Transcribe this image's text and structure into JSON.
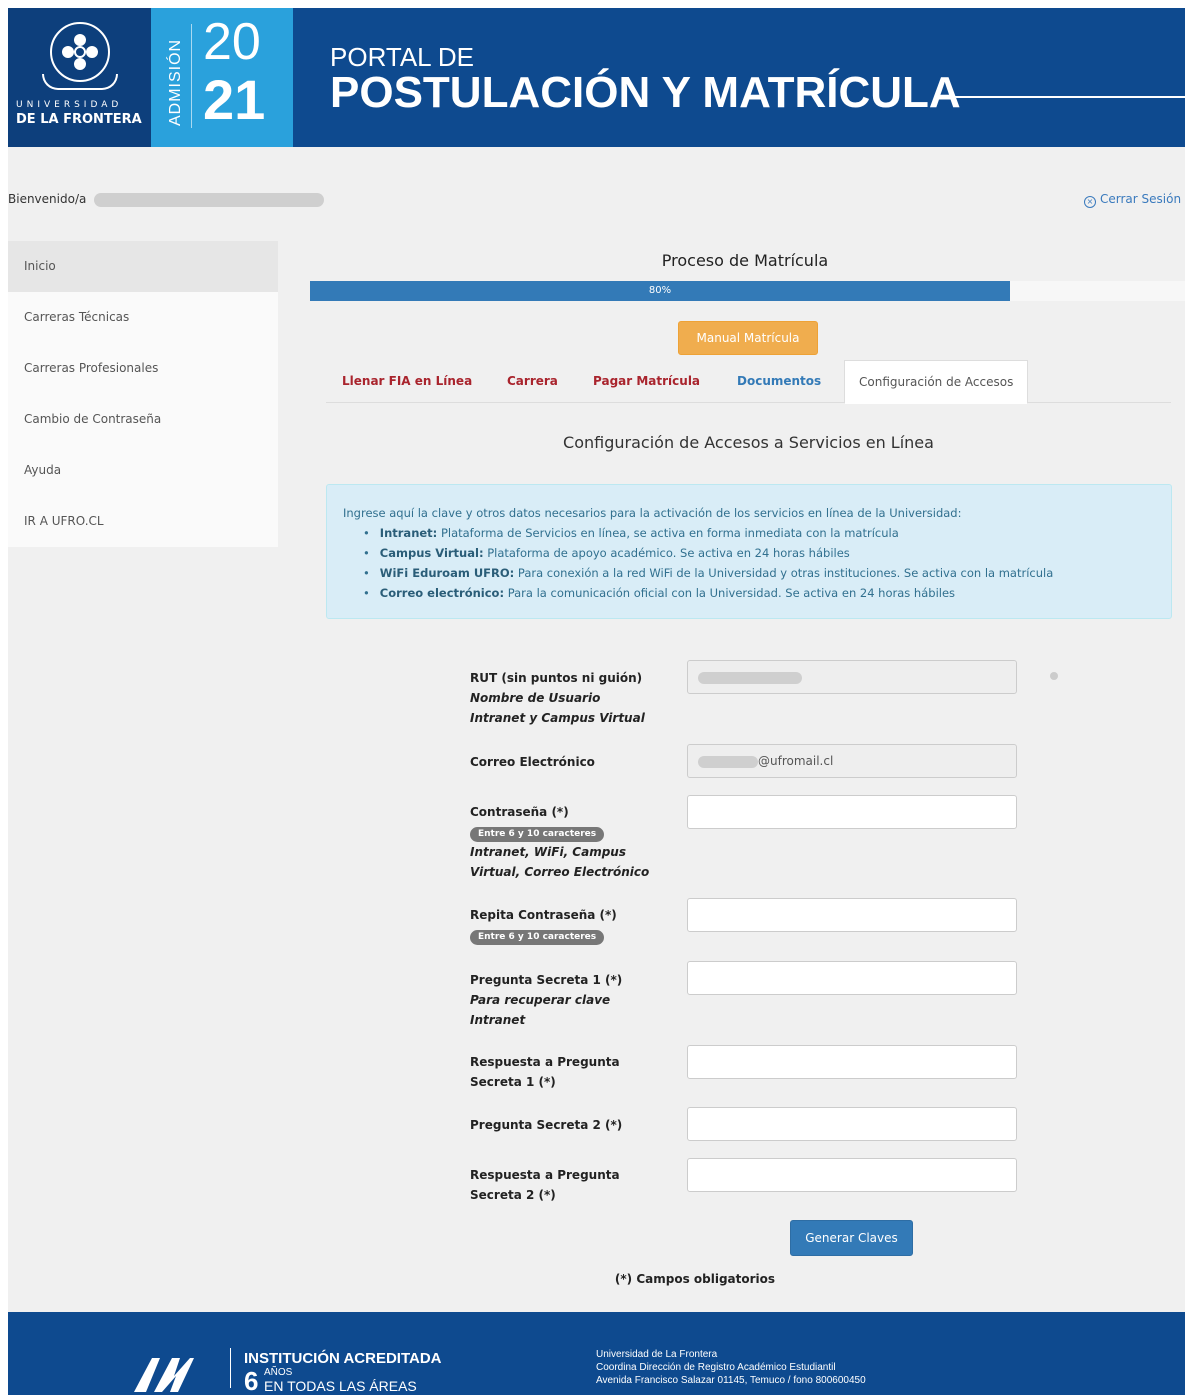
{
  "header": {
    "university_top": "UNIVERSIDAD",
    "university_bottom": "DE LA FRONTERA",
    "admision": "ADMISIÓN",
    "year_top": "20",
    "year_bottom": "21",
    "portal_small": "PORTAL DE",
    "portal_big": "POSTULACIÓN Y MATRÍCULA"
  },
  "welcome": {
    "label": "Bienvenido/a"
  },
  "logout": {
    "icon": "close-circle-icon",
    "label": "Cerrar Sesión"
  },
  "sidebar": {
    "items": [
      {
        "label": "Inicio",
        "active": true
      },
      {
        "label": "Carreras Técnicas"
      },
      {
        "label": "Carreras Profesionales"
      },
      {
        "label": "Cambio de Contraseña"
      },
      {
        "label": "Ayuda"
      },
      {
        "label": "IR A UFRO.CL"
      }
    ]
  },
  "process": {
    "title": "Proceso de Matrícula",
    "progress": 80,
    "progress_label": "80%"
  },
  "manual_button": "Manual Matrícula",
  "tabs": [
    {
      "label": "Llenar FIA en Línea"
    },
    {
      "label": "Carrera"
    },
    {
      "label": "Pagar Matrícula"
    },
    {
      "label": "Documentos"
    },
    {
      "label": "Configuración de Accesos"
    }
  ],
  "section_title": "Configuración de Accesos a Servicios en Línea",
  "info": {
    "intro": "Ingrese aquí la clave y otros datos necesarios para la activación de los servicios en línea de la Universidad:",
    "items": [
      {
        "name": "Intranet:",
        "desc": "Plataforma de Servicios en línea, se activa en forma inmediata con la matrícula"
      },
      {
        "name": "Campus Virtual:",
        "desc": "Plataforma de apoyo académico. Se activa en 24 horas hábiles"
      },
      {
        "name": "WiFi Eduroam UFRO:",
        "desc": "Para conexión a la red WiFi de la Universidad y otras instituciones. Se activa con la matrícula"
      },
      {
        "name": "Correo electrónico:",
        "desc": "Para la comunicación oficial con la Universidad. Se activa en 24 horas hábiles"
      }
    ]
  },
  "form": {
    "rut": {
      "label": "RUT (sin puntos ni guión)",
      "sub1": "Nombre de Usuario",
      "sub2": "Intranet y Campus Virtual"
    },
    "email": {
      "label": "Correo Electrónico",
      "value": "@ufromail.cl"
    },
    "password": {
      "label": "Contraseña (*)",
      "badge": "Entre 6 y 10 caracteres",
      "sub1": "Intranet, WiFi, Campus",
      "sub2": "Virtual, Correo Electrónico"
    },
    "password_repeat": {
      "label": "Repita Contraseña (*)",
      "badge": "Entre 6 y 10 caracteres"
    },
    "question1": {
      "label": "Pregunta Secreta 1 (*)",
      "sub1": "Para recuperar clave",
      "sub2": "Intranet"
    },
    "answer1": {
      "label1": "Respuesta a Pregunta",
      "label2": "Secreta 1 (*)"
    },
    "question2": {
      "label": "Pregunta Secreta 2 (*)"
    },
    "answer2": {
      "label1": "Respuesta a Pregunta",
      "label2": "Secreta 2 (*)"
    },
    "submit": "Generar Claves",
    "required_note": "(*) Campos obligatorios"
  },
  "footer": {
    "acred_line1": "INSTITUCIÓN ACREDITADA",
    "acred_num": "6",
    "acred_years": "AÑOS",
    "acred_line3": "EN TODAS LAS ÁREAS",
    "addr1": "Universidad de La Frontera",
    "addr2": "Coordina Dirección de Registro Académico Estudiantil",
    "addr3": "Avenida Francisco Salazar 01145, Temuco / fono 800600450"
  }
}
